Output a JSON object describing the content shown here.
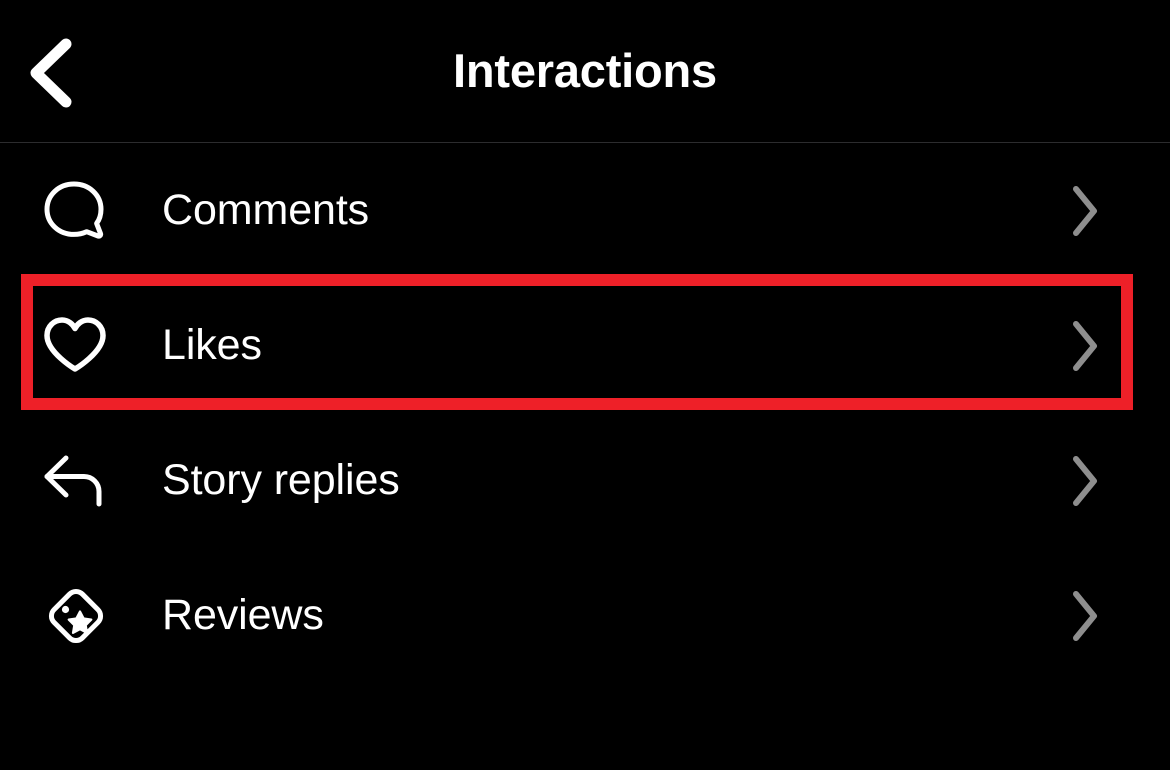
{
  "header": {
    "title": "Interactions",
    "back_icon": "chevron-left-icon"
  },
  "colors": {
    "background": "#000000",
    "text": "#ffffff",
    "chevron": "#8e8e8e",
    "divider": "#2c2c2e",
    "highlight": "#ee2028"
  },
  "list": {
    "items": [
      {
        "label": "Comments",
        "icon": "comment-bubble-icon",
        "chevron": "chevron-right-icon",
        "highlighted": false
      },
      {
        "label": "Likes",
        "icon": "heart-icon",
        "chevron": "chevron-right-icon",
        "highlighted": true
      },
      {
        "label": "Story replies",
        "icon": "reply-arrow-icon",
        "chevron": "chevron-right-icon",
        "highlighted": false
      },
      {
        "label": "Reviews",
        "icon": "tag-star-icon",
        "chevron": "chevron-right-icon",
        "highlighted": false
      }
    ]
  },
  "highlight": {
    "target_label": "Likes"
  }
}
